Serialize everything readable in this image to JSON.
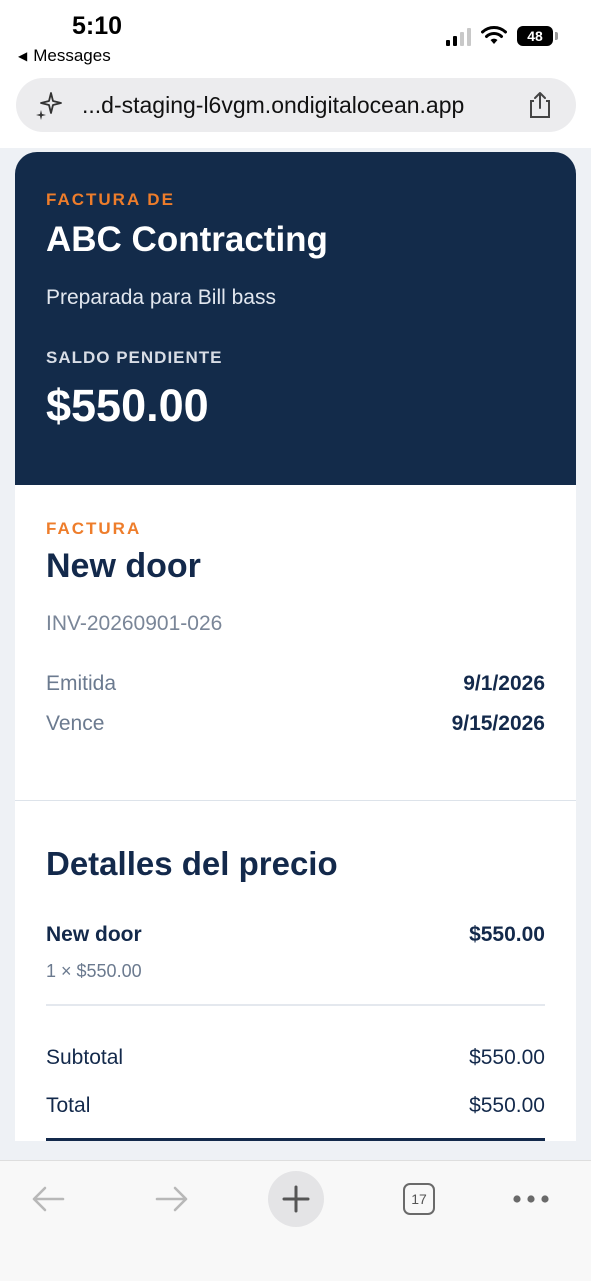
{
  "status_bar": {
    "time": "5:10",
    "back_app": "Messages",
    "battery": "48"
  },
  "browser": {
    "url": "...d-staging-l6vgm.ondigitalocean.app",
    "tab_count": "17"
  },
  "hero": {
    "eyebrow": "FACTURA DE",
    "company": "ABC Contracting",
    "prepared_for": "Preparada para Bill bass",
    "balance_label": "SALDO PENDIENTE",
    "balance_amount": "$550.00"
  },
  "invoice": {
    "eyebrow": "FACTURA",
    "title": "New door",
    "number": "INV-20260901-026",
    "issued_label": "Emitida",
    "issued_value": "9/1/2026",
    "due_label": "Vence",
    "due_value": "9/15/2026"
  },
  "pricing": {
    "title": "Detalles del precio",
    "line_items": [
      {
        "name": "New door",
        "amount": "$550.00",
        "qty": "1 × $550.00"
      }
    ],
    "subtotal_label": "Subtotal",
    "subtotal_value": "$550.00",
    "total_label": "Total",
    "total_value": "$550.00"
  },
  "colors": {
    "navy": "#132b4a",
    "orange": "#ee7d2b"
  }
}
